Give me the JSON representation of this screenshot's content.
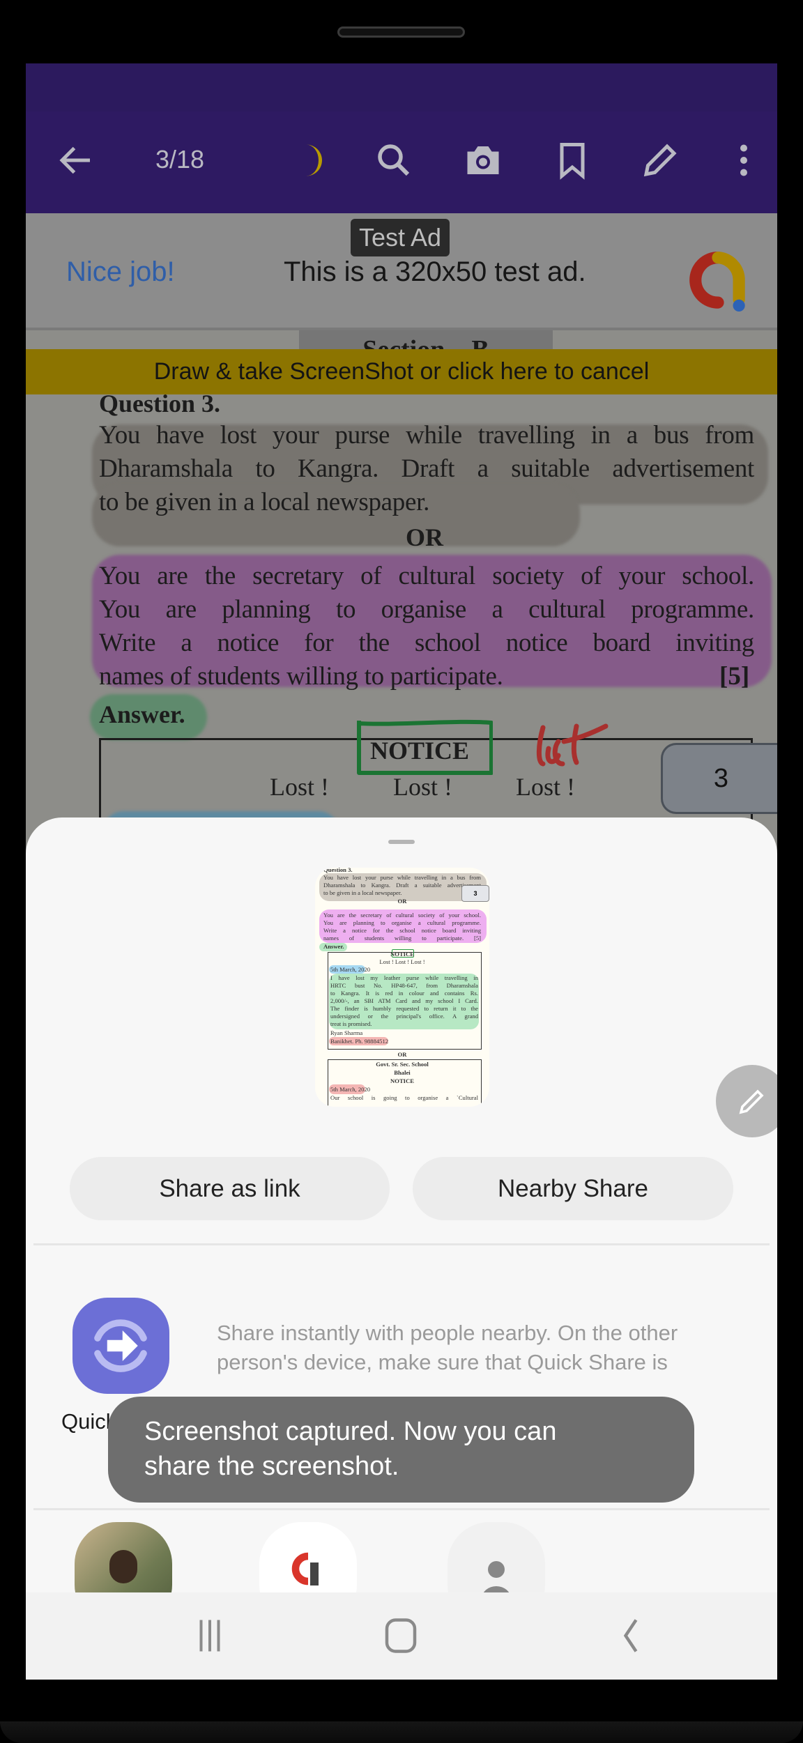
{
  "toolbar": {
    "page_indicator": "3/18",
    "icons": [
      "back-arrow-icon",
      "night-mode-moon-icon",
      "search-icon",
      "camera-icon",
      "bookmark-icon",
      "pencil-icon",
      "more-vert-icon"
    ],
    "accent": "#2e1a62"
  },
  "ad": {
    "chip": "Test Ad",
    "headline": "Nice job!",
    "body": "This is a 320x50 test ad."
  },
  "screenshot_bar": {
    "label": "Draw & take ScreenShot or click here to cancel",
    "color": "#8c7400"
  },
  "document": {
    "section": "Section – B",
    "question": "Question 3.",
    "q_lines": [
      "You have lost your purse while travelling in a bus from",
      "Dharamshala to Kangra. Draft a suitable advertisement",
      "to be given in a local newspaper."
    ],
    "or": "OR",
    "alt_lines": [
      "You are the secretary of cultural society of your school.",
      "You are planning to organise a cultural programme.",
      "Write a notice for the school notice board inviting",
      "names of students willing to participate."
    ],
    "marks": "[5]",
    "answer": "Answer.",
    "notice": "NOTICE",
    "lost": [
      "Lost !",
      "Lost !",
      "Lost !"
    ],
    "page_badge": "3"
  },
  "share_sheet": {
    "thumbnail": {
      "lines": [
        "Question 3.",
        "You have lost your purse while travelling in a bus from",
        "Dharamshala to Kangra. Draft a suitable advertisement",
        "to be given in a local newspaper.",
        "OR",
        "You are the secretary of cultural society of your school.",
        "You are planning to organise a cultural programme.",
        "Write a notice for the school notice board inviting",
        "names of students willing to participate.          [5]",
        "Answer."
      ],
      "badge": "3",
      "notice": "NOTICE",
      "lost": "Lost !        Lost !        Lost !",
      "date1": "5th March, 2020",
      "body": [
        "I have lost my leather purse while travelling in",
        "HRTC bust No. HP48-647, from Dharamshala",
        "to Kangra. It is red in colour and contains Rs.",
        "2,000/-, an SBI ATM Card and my school I Card.",
        "The finder is humbly requested to return it to the",
        "undersigned or the principal's office. A grand",
        "treat is promised."
      ],
      "name": "Ryan Sharma",
      "address": "Banikhet. Ph. 98884512",
      "or": "OR",
      "school": "Govt. Sr. Sec. School",
      "place": "Bhalei",
      "notice2": "NOTICE",
      "date2": "5th March, 2020",
      "body2": "Our school is going to organise a `Cultural"
    },
    "share_as_link": "Share as link",
    "nearby_share": "Nearby Share",
    "quick_share": {
      "label": "Quick Share",
      "description": "Share instantly with people nearby. On the other person's device, make sure that Quick Share is"
    },
    "brand_color": "#6c6fd6"
  },
  "toast": {
    "message_line1": "Screenshot captured. Now you can",
    "message_line2": "share the screenshot."
  }
}
